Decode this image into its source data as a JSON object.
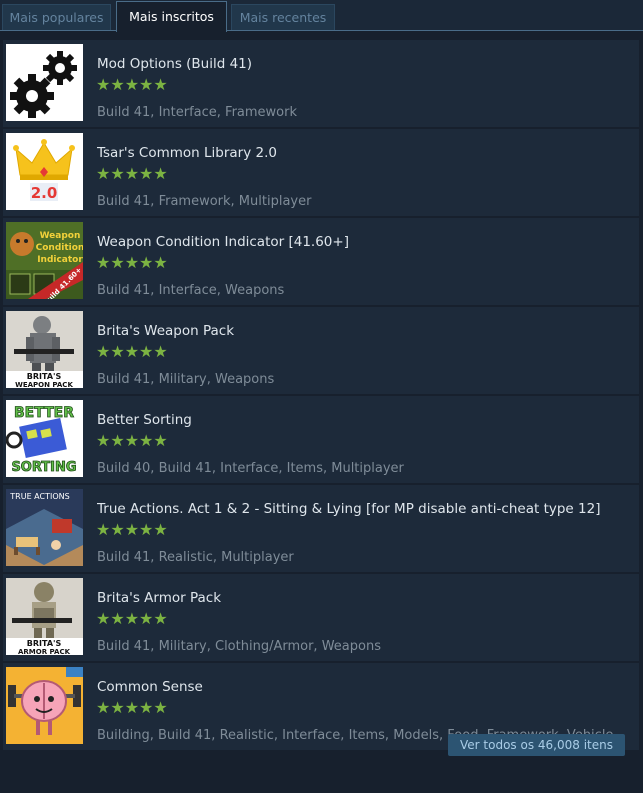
{
  "tabs": [
    {
      "label": "Mais populares",
      "active": false
    },
    {
      "label": "Mais inscritos",
      "active": true
    },
    {
      "label": "Mais recentes",
      "active": false
    }
  ],
  "items": [
    {
      "title": "Mod Options (Build 41)",
      "stars": "★★★★★",
      "rating": 5,
      "tags": "Build 41, Interface, Framework",
      "thumb": "gears-icon"
    },
    {
      "title": "Tsar's Common Library 2.0",
      "stars": "★★★★★",
      "rating": 5,
      "tags": "Build 41, Framework, Multiplayer",
      "thumb": "crown-icon",
      "thumb_text": "2.0"
    },
    {
      "title": "Weapon Condition Indicator [41.60+]",
      "stars": "★★★★★",
      "rating": 5,
      "tags": "Build 41, Interface, Weapons",
      "thumb": "weapon-condition-thumb",
      "thumb_text": "Weapon Condition Indicator",
      "thumb_ribbon": "Build 41.60+"
    },
    {
      "title": "Brita's Weapon Pack",
      "stars": "★★★★★",
      "rating": 5,
      "tags": "Build 41, Military, Weapons",
      "thumb": "soldier-thumb",
      "thumb_text": "BRITA'S WEAPON PACK"
    },
    {
      "title": "Better Sorting",
      "stars": "★★★★★",
      "rating": 5,
      "tags": "Build 40, Build 41, Interface, Items, Multiplayer",
      "thumb": "sorting-thumb",
      "thumb_text": "BETTER SORTING"
    },
    {
      "title": "True Actions. Act 1 & 2 - Sitting & Lying [for MP disable anti-cheat type 12]",
      "stars": "★★★★★",
      "rating": 5,
      "tags": "Build 41, Realistic, Multiplayer",
      "thumb": "room-thumb",
      "thumb_text": "TRUE ACTIONS"
    },
    {
      "title": "Brita's Armor Pack",
      "stars": "★★★★★",
      "rating": 5,
      "tags": "Build 41, Military, Clothing/Armor, Weapons",
      "thumb": "armor-thumb",
      "thumb_text": "BRITA'S ARMOR PACK"
    },
    {
      "title": "Common Sense",
      "stars": "★★★★★",
      "rating": 5,
      "tags": "Building, Build 41, Realistic, Interface, Items, Models, Food, Framework, Vehicles, ...",
      "thumb": "brain-icon"
    }
  ],
  "footer": {
    "view_all": "Ver todos os 46,008 itens"
  },
  "colors": {
    "background": "#1b2838",
    "row": "#1d2a3a",
    "stars": "#7cb342",
    "button": "#2c5472"
  }
}
